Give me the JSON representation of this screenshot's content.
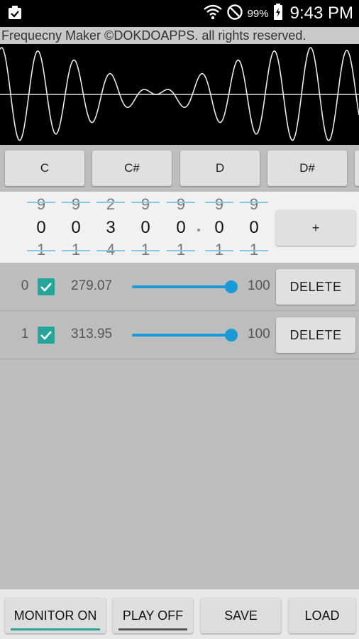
{
  "status_bar": {
    "battery_percent": "99%",
    "time": "9:43 PM",
    "icons": [
      "clipboard-check-icon",
      "wifi-icon",
      "do-not-disturb-icon",
      "battery-charging-icon"
    ]
  },
  "app": {
    "header": "Frequecny Maker ©DOKDOAPPS. all rights reserved."
  },
  "notes": [
    "C",
    "C#",
    "D",
    "D#"
  ],
  "picker": {
    "digits": [
      {
        "prev": "9",
        "cur": "0",
        "next": "1"
      },
      {
        "prev": "9",
        "cur": "0",
        "next": "1"
      },
      {
        "prev": "2",
        "cur": "3",
        "next": "4"
      },
      {
        "prev": "9",
        "cur": "0",
        "next": "1"
      },
      {
        "prev": "9",
        "cur": "0",
        "next": "1"
      },
      {
        "prev": "9",
        "cur": "0",
        "next": "1"
      },
      {
        "prev": "9",
        "cur": "0",
        "next": "1"
      }
    ],
    "add_label": "+"
  },
  "tones": [
    {
      "index": "0",
      "checked": true,
      "frequency": "279.07",
      "volume_value": 100,
      "volume_label": "100",
      "delete_label": "DELETE"
    },
    {
      "index": "1",
      "checked": true,
      "frequency": "313.95",
      "volume_value": 100,
      "volume_label": "100",
      "delete_label": "DELETE"
    }
  ],
  "bottom": {
    "monitor_label": "MONITOR ON",
    "play_label": "PLAY OFF",
    "save_label": "SAVE",
    "load_label": "LOAD"
  },
  "colors": {
    "accent": "#26a69a",
    "slider": "#1a9bd7",
    "monitor_indicator": "#26a69a",
    "play_indicator": "#555555"
  }
}
